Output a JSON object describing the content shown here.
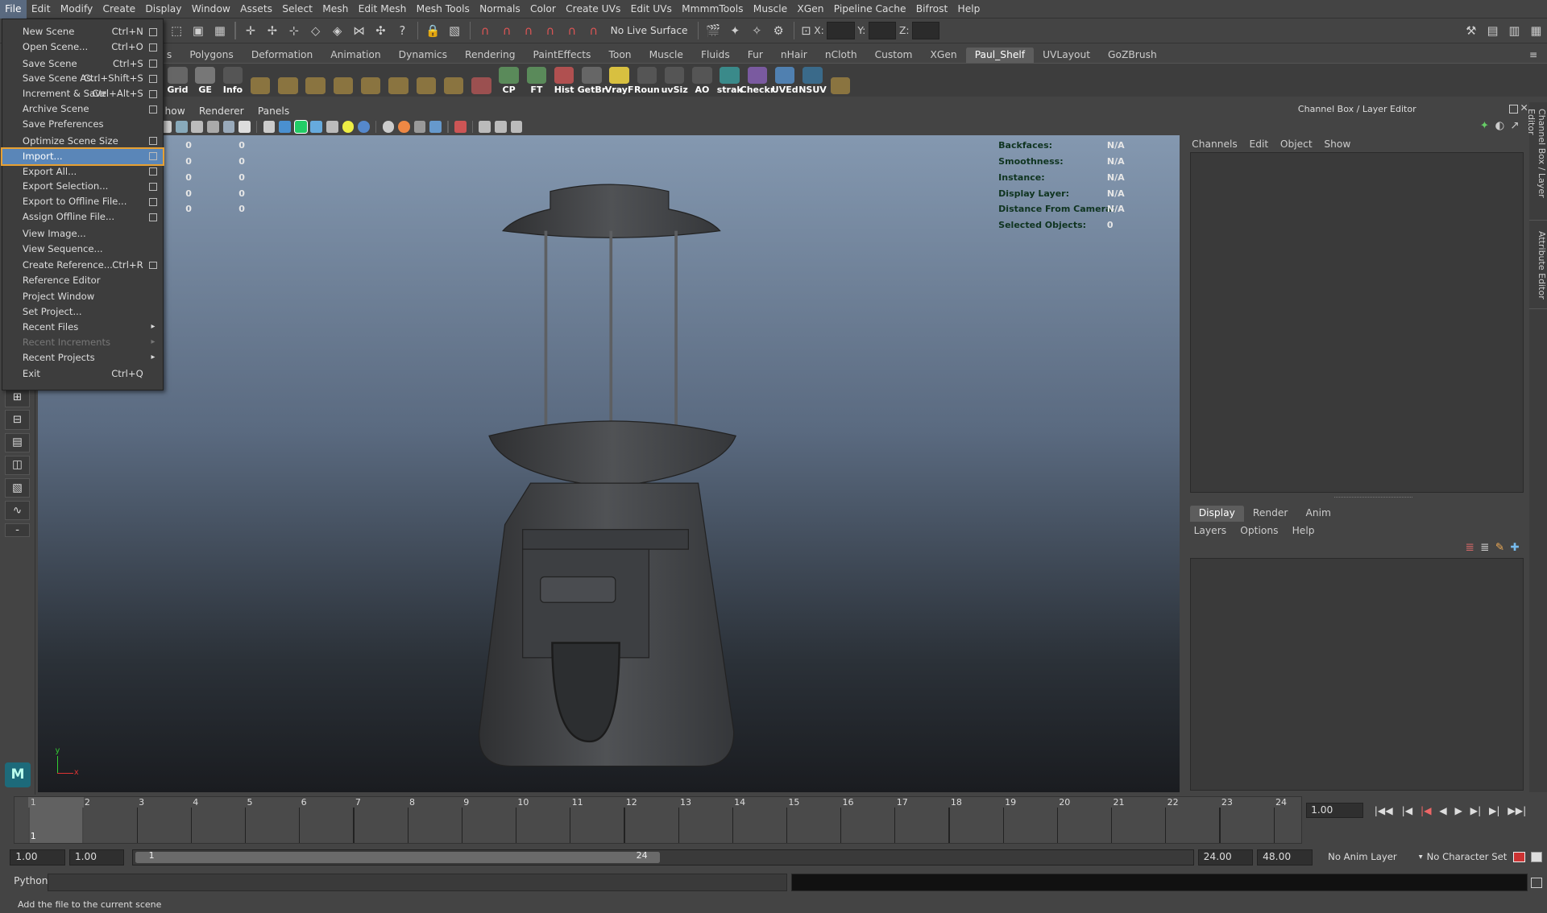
{
  "menubar": {
    "items": [
      "File",
      "Edit",
      "Modify",
      "Create",
      "Display",
      "Window",
      "Assets",
      "Select",
      "Mesh",
      "Edit Mesh",
      "Mesh Tools",
      "Normals",
      "Color",
      "Create UVs",
      "Edit UVs",
      "MmmmTools",
      "Muscle",
      "XGen",
      "Pipeline Cache",
      "Bifrost",
      "Help"
    ]
  },
  "statusline": {
    "live_surface": "No Live Surface",
    "x_label": "X:",
    "y_label": "Y:",
    "z_label": "Z:"
  },
  "shelf": {
    "tabs": [
      "s",
      "Polygons",
      "Deformation",
      "Animation",
      "Dynamics",
      "Rendering",
      "PaintEffects",
      "Toon",
      "Muscle",
      "Fluids",
      "Fur",
      "nHair",
      "nCloth",
      "Custom",
      "XGen",
      "Paul_Shelf",
      "UVLayout",
      "GoZBrush"
    ],
    "active_tab": "Paul_Shelf",
    "items": [
      {
        "label": "Grid",
        "color": "#666666"
      },
      {
        "label": "GE",
        "color": "#777777"
      },
      {
        "label": "Info",
        "color": "#555555"
      },
      {
        "label": "",
        "color": "#8a7440"
      },
      {
        "label": "",
        "color": "#8a7440"
      },
      {
        "label": "",
        "color": "#8a7440"
      },
      {
        "label": "",
        "color": "#8a7440"
      },
      {
        "label": "",
        "color": "#8a7440"
      },
      {
        "label": "",
        "color": "#8a7440"
      },
      {
        "label": "",
        "color": "#8a7440"
      },
      {
        "label": "",
        "color": "#8a7440"
      },
      {
        "label": "",
        "color": "#9b5050"
      },
      {
        "label": "CP",
        "color": "#5a8a5a"
      },
      {
        "label": "FT",
        "color": "#5a8a5a"
      },
      {
        "label": "Hist",
        "color": "#b05050"
      },
      {
        "label": "GetBr",
        "color": "#666666"
      },
      {
        "label": "VrayF",
        "color": "#d8c040"
      },
      {
        "label": "Roun",
        "color": "#555555"
      },
      {
        "label": "uvSiz",
        "color": "#555555"
      },
      {
        "label": "AO",
        "color": "#555555"
      },
      {
        "label": "strak",
        "color": "#3a8a8a"
      },
      {
        "label": "Checkr",
        "color": "#7a5aa0"
      },
      {
        "label": "UVEd",
        "color": "#5080b0"
      },
      {
        "label": "NSUV",
        "color": "#3a6a8a"
      },
      {
        "label": "",
        "color": "#8a7440"
      }
    ]
  },
  "file_menu": {
    "items": [
      {
        "label": "New Scene",
        "shortcut": "Ctrl+N",
        "options": true
      },
      {
        "label": "Open Scene...",
        "shortcut": "Ctrl+O",
        "options": true
      },
      {
        "label": "Save Scene",
        "shortcut": "Ctrl+S",
        "options": true,
        "gap": true
      },
      {
        "label": "Save Scene As...",
        "shortcut": "Ctrl+Shift+S",
        "options": true
      },
      {
        "label": "Increment & Save",
        "shortcut": "Ctrl+Alt+S",
        "options": true
      },
      {
        "label": "Archive Scene",
        "shortcut": "",
        "options": true
      },
      {
        "label": "Save Preferences",
        "shortcut": "",
        "options": false
      },
      {
        "label": "Optimize Scene Size",
        "shortcut": "",
        "options": true,
        "gap": true
      },
      {
        "label": "Import...",
        "shortcut": "",
        "options": true,
        "highlight": true
      },
      {
        "label": "Export All...",
        "shortcut": "",
        "options": true
      },
      {
        "label": "Export Selection...",
        "shortcut": "",
        "options": true
      },
      {
        "label": "Export to Offline File...",
        "shortcut": "",
        "options": true
      },
      {
        "label": "Assign Offline File...",
        "shortcut": "",
        "options": true
      },
      {
        "label": "View Image...",
        "shortcut": "",
        "options": false,
        "gap": true
      },
      {
        "label": "View Sequence...",
        "shortcut": "",
        "options": false
      },
      {
        "label": "Create Reference...",
        "shortcut": "Ctrl+R",
        "options": true,
        "gap": true
      },
      {
        "label": "Reference Editor",
        "shortcut": "",
        "options": false
      },
      {
        "label": "Project Window",
        "shortcut": "",
        "options": false,
        "gap": true
      },
      {
        "label": "Set Project...",
        "shortcut": "",
        "options": false
      },
      {
        "label": "Recent Files",
        "shortcut": "",
        "submenu": true
      },
      {
        "label": "Recent Increments",
        "shortcut": "",
        "submenu": true,
        "disabled": true
      },
      {
        "label": "Recent Projects",
        "shortcut": "",
        "submenu": true
      },
      {
        "label": "Exit",
        "shortcut": "Ctrl+Q",
        "options": false,
        "gap": true
      }
    ]
  },
  "viewport": {
    "menu": [
      "how",
      "Renderer",
      "Panels"
    ],
    "hud_left": [
      [
        "0",
        "0"
      ],
      [
        "0",
        "0"
      ],
      [
        "0",
        "0"
      ],
      [
        "0",
        "0"
      ],
      [
        "0",
        "0"
      ]
    ],
    "hud_right": [
      {
        "label": "Backfaces:",
        "value": "N/A"
      },
      {
        "label": "Smoothness:",
        "value": "N/A"
      },
      {
        "label": "Instance:",
        "value": "N/A"
      },
      {
        "label": "Display Layer:",
        "value": "N/A"
      },
      {
        "label": "Distance From Camera:",
        "value": "N/A"
      },
      {
        "label": "Selected Objects:",
        "value": "0"
      }
    ],
    "axis_y": "y",
    "axis_x": "x"
  },
  "channel_box": {
    "title": "Channel Box / Layer Editor",
    "menu": [
      "Channels",
      "Edit",
      "Object",
      "Show"
    ]
  },
  "layer_editor": {
    "tabs": [
      "Display",
      "Render",
      "Anim"
    ],
    "active_tab": "Display",
    "menu": [
      "Layers",
      "Options",
      "Help"
    ]
  },
  "side_tabs": [
    "Channel Box / Layer Editor",
    "Attribute Editor"
  ],
  "timeline": {
    "ticks": [
      "1",
      "2",
      "3",
      "4",
      "5",
      "6",
      "7",
      "8",
      "9",
      "10",
      "11",
      "12",
      "13",
      "14",
      "15",
      "16",
      "17",
      "18",
      "19",
      "20",
      "21",
      "22",
      "23",
      "24"
    ],
    "current_frame": "1",
    "current_time": "1.00"
  },
  "range": {
    "start": "1.00",
    "playback_start": "1.00",
    "slider_start": "1",
    "slider_end": "24",
    "playback_end": "24.00",
    "end": "48.00",
    "anim_layer": "No Anim Layer",
    "character_set": "No Character Set"
  },
  "command_line": {
    "language": "Python"
  },
  "help_line": {
    "text": "Add the file to the current scene"
  }
}
